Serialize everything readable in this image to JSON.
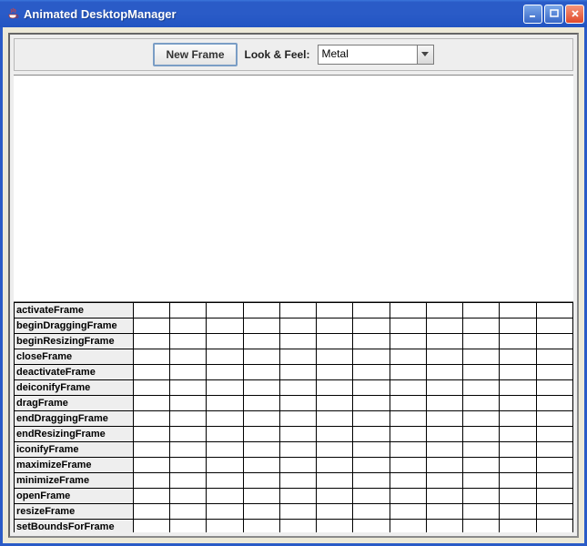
{
  "window": {
    "title": "Animated DesktopManager"
  },
  "toolbar": {
    "newFrameLabel": "New Frame",
    "lookFeelLabel": "Look & Feel:",
    "lookFeelValue": "Metal"
  },
  "methods": [
    "activateFrame",
    "beginDraggingFrame",
    "beginResizingFrame",
    "closeFrame",
    "deactivateFrame",
    "deiconifyFrame",
    "dragFrame",
    "endDraggingFrame",
    "endResizingFrame",
    "iconifyFrame",
    "maximizeFrame",
    "minimizeFrame",
    "openFrame",
    "resizeFrame",
    "setBoundsForFrame"
  ],
  "columnCount": 12
}
